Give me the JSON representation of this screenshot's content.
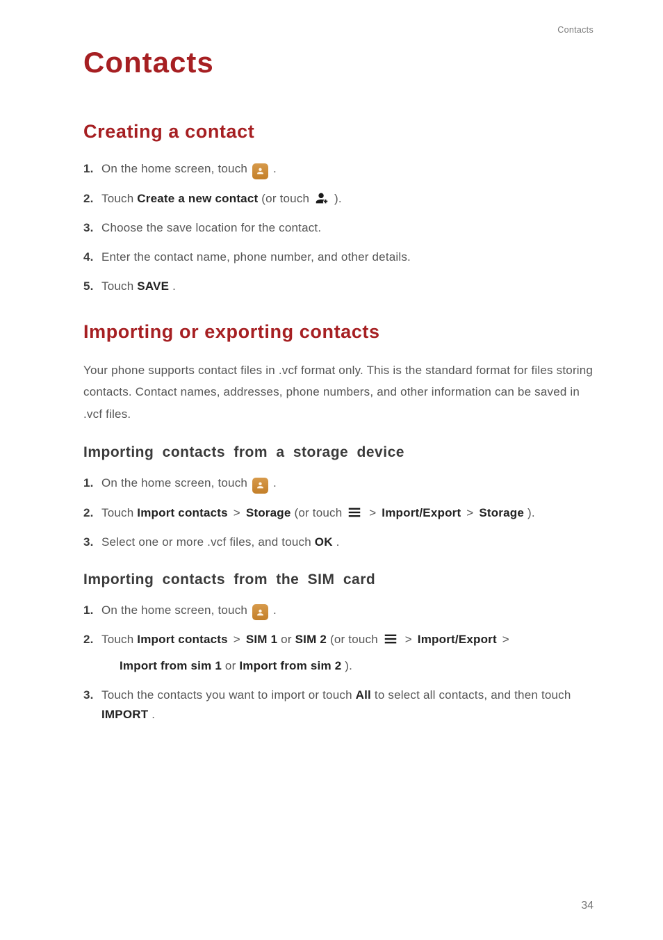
{
  "running_header": "Contacts",
  "chapter_title": "Contacts",
  "page_number": "34",
  "section1": {
    "title": "Creating a contact",
    "steps": {
      "s1_num": "1.",
      "s1_a": "On the home screen, touch ",
      "s1_b": ".",
      "s2_num": "2.",
      "s2_a": "Touch ",
      "s2_bold": "Create a new contact",
      "s2_b": " (or touch ",
      "s2_c": ").",
      "s3_num": "3.",
      "s3": "Choose the save location for the contact.",
      "s4_num": "4.",
      "s4": "Enter the contact name, phone number, and other details.",
      "s5_num": "5.",
      "s5_a": "Touch ",
      "s5_bold": "SAVE",
      "s5_b": "."
    }
  },
  "section2": {
    "title": "Importing or exporting contacts",
    "intro": "Your phone supports contact files in .vcf format only. This is the standard format for files storing contacts. Contact names, addresses, phone numbers, and other information can be saved in .vcf files.",
    "sub1": {
      "title": "Importing contacts from a storage device",
      "s1_num": "1.",
      "s1_a": "On the home screen, touch ",
      "s1_b": ".",
      "s2_num": "2.",
      "s2_a": "Touch ",
      "s2_b1": "Import contacts",
      "s2_gt1": " > ",
      "s2_b2": "Storage",
      "s2_c": " (or touch ",
      "s2_gt2": " > ",
      "s2_b3": "Import/Export",
      "s2_gt3": " > ",
      "s2_b4": "Storage",
      "s2_d": ").",
      "s3_num": "3.",
      "s3_a": "Select one or more .vcf files, and touch ",
      "s3_bold": "OK",
      "s3_b": "."
    },
    "sub2": {
      "title": "Importing contacts from the SIM card",
      "s1_num": "1.",
      "s1_a": "On the home screen, touch ",
      "s1_b": ".",
      "s2_num": "2.",
      "s2_a": "Touch ",
      "s2_b1": "Import contacts",
      "s2_gt1": " > ",
      "s2_b2": "SIM 1",
      "s2_or": " or",
      "s2_b3": "SIM 2",
      "s2_c": " (or touch ",
      "s2_gt2": " > ",
      "s2_b4": "Import/Export",
      "s2_gt3": " > ",
      "s2_line2a": "Import from sim 1",
      "s2_line2or": " or ",
      "s2_line2b": "Import from sim 2",
      "s2_line2c": ").",
      "s3_num": "3.",
      "s3_a": "Touch the contacts you want to import or touch ",
      "s3_bold1": "All",
      "s3_b": " to select all contacts, and then touch ",
      "s3_bold2": "IMPORT",
      "s3_c": "."
    }
  }
}
